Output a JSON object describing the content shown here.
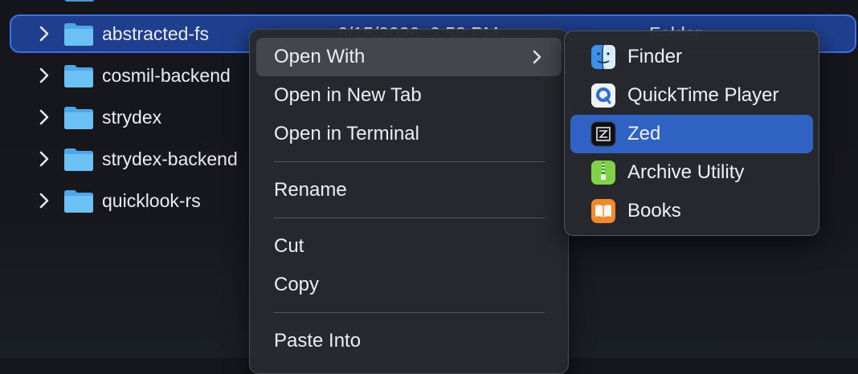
{
  "finder": {
    "rows": [
      {
        "name": "abstracted-fs",
        "date": "6/15/2026, 2:58 PM",
        "kind": "Folder",
        "selected": true
      },
      {
        "name": "cosmil-backend"
      },
      {
        "name": "strydex"
      },
      {
        "name": "strydex-backend"
      },
      {
        "name": "quicklook-rs"
      }
    ]
  },
  "context_menu": {
    "items": [
      {
        "label": "Open With",
        "has_submenu": true,
        "highlighted": true
      },
      {
        "label": "Open in New Tab"
      },
      {
        "label": "Open in Terminal"
      },
      {
        "label": "Rename"
      },
      {
        "label": "Cut"
      },
      {
        "label": "Copy"
      },
      {
        "label": "Paste Into"
      }
    ]
  },
  "open_with_submenu": {
    "items": [
      {
        "label": "Finder",
        "icon": "finder-icon"
      },
      {
        "label": "QuickTime Player",
        "icon": "quicktime-icon"
      },
      {
        "label": "Zed",
        "icon": "zed-icon",
        "selected": true
      },
      {
        "label": "Archive Utility",
        "icon": "archive-utility-icon"
      },
      {
        "label": "Books",
        "icon": "books-icon"
      }
    ]
  },
  "colors": {
    "selection": "#1f3f8e",
    "selection_border": "#3c72e6",
    "submenu_selected": "#2f62c2",
    "folder": "#5cb6f0"
  }
}
